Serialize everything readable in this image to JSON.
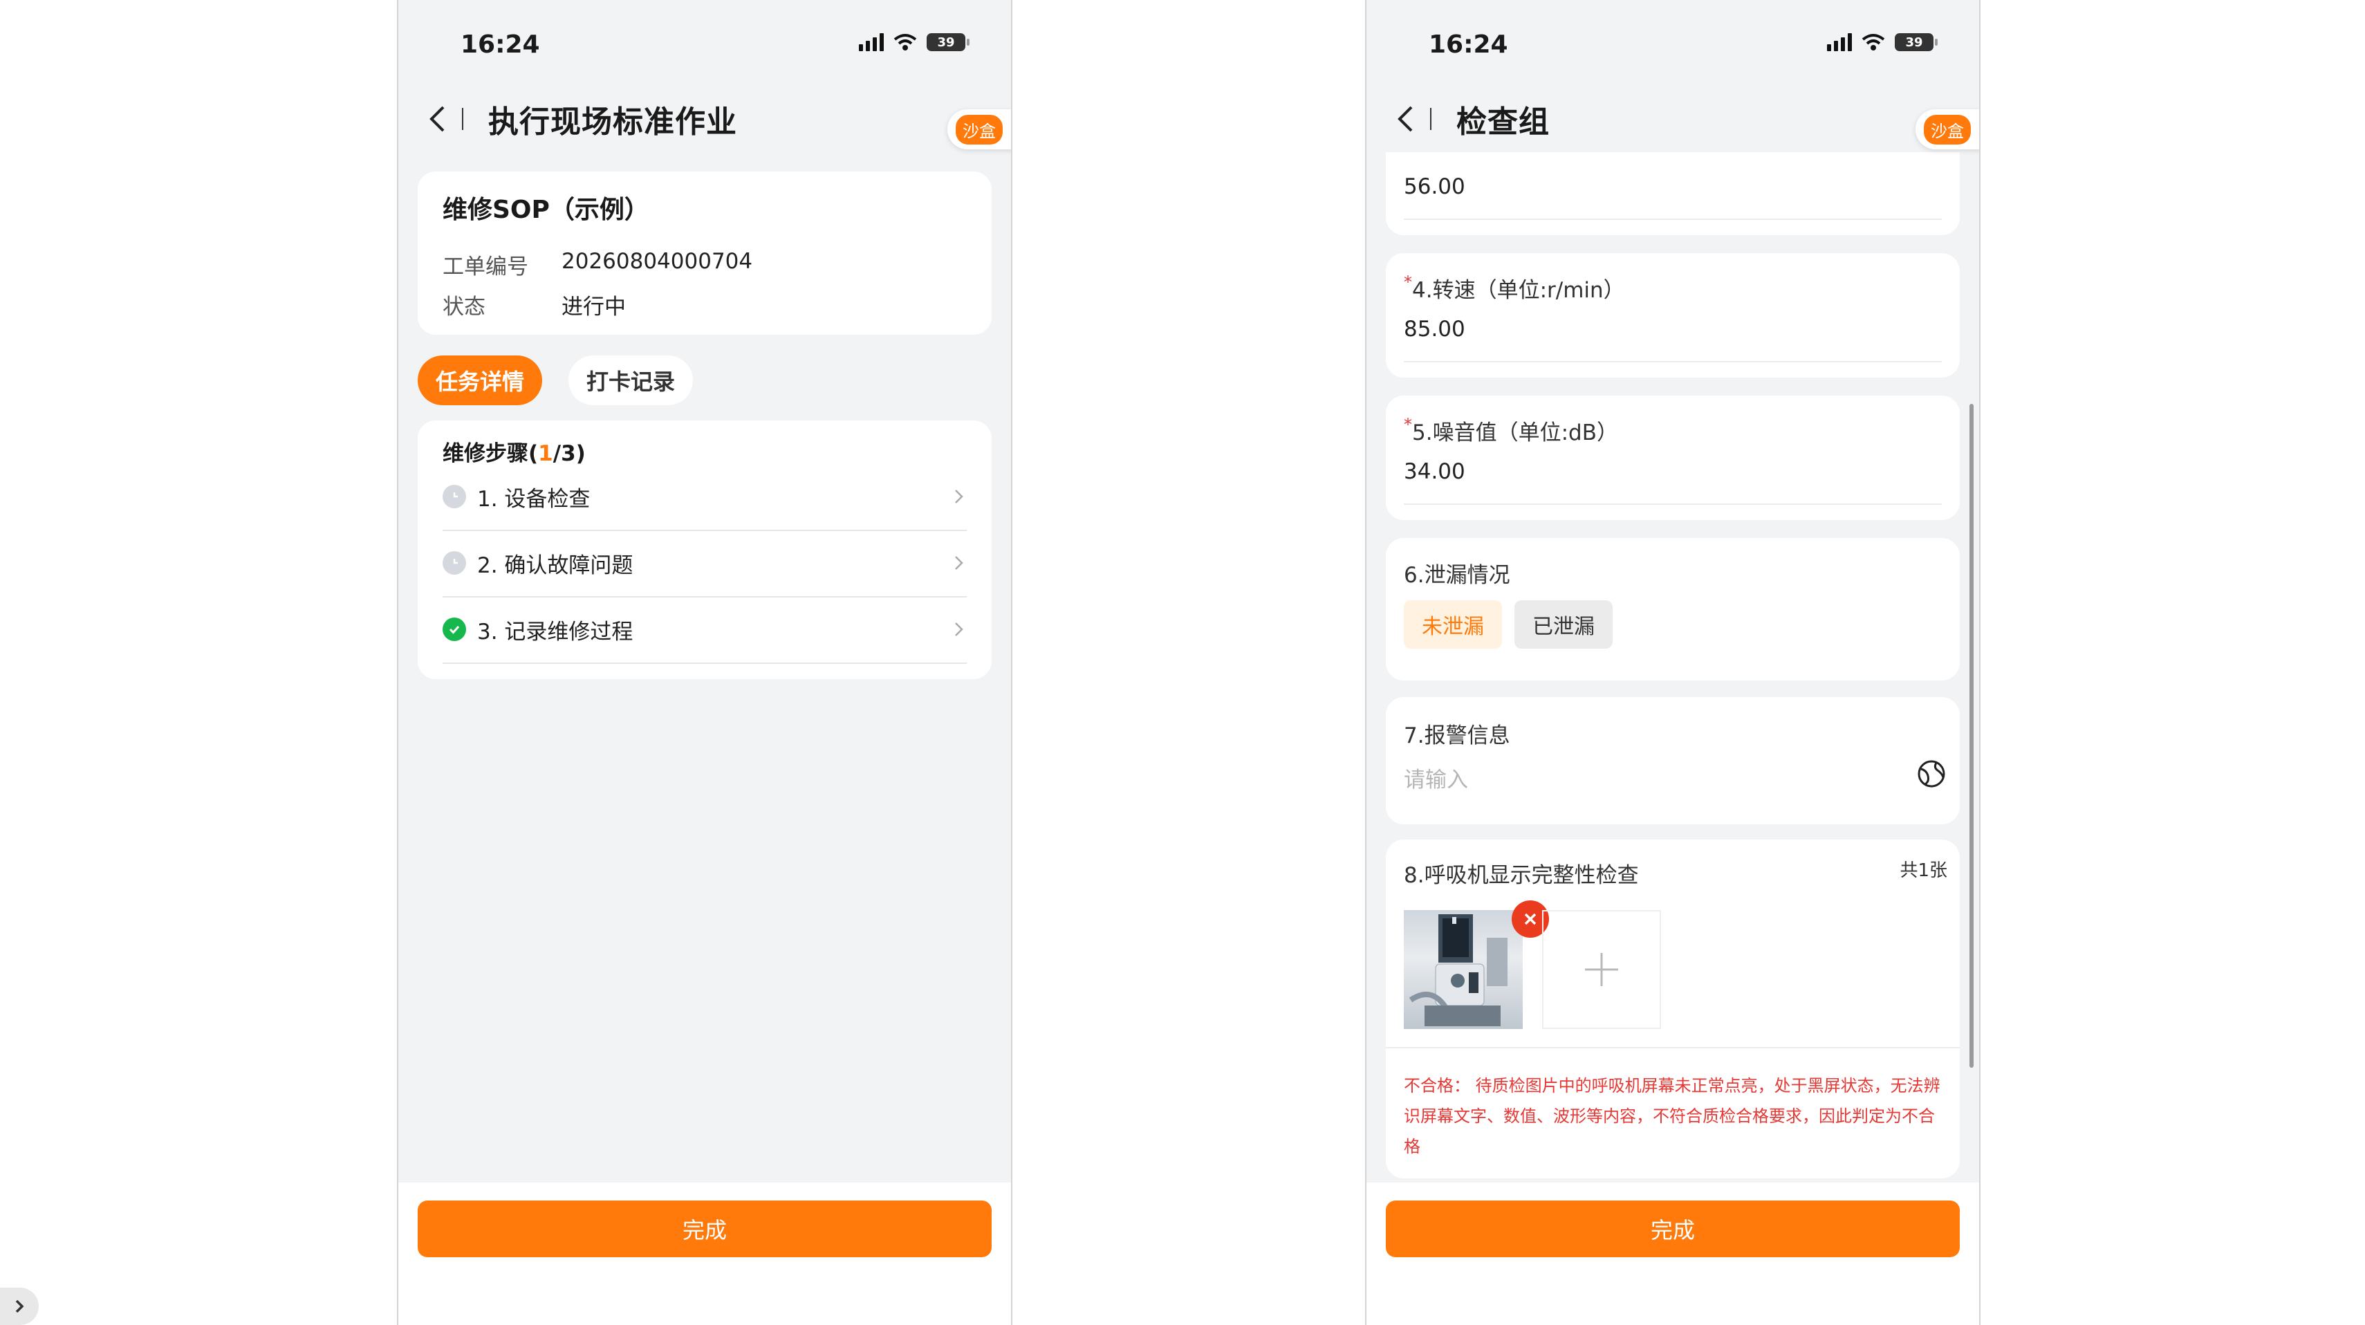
{
  "left_screen": {
    "status": {
      "time": "16:24",
      "battery": "39"
    },
    "nav": {
      "title": "执行现场标准作业",
      "sandbox_label": "沙盒"
    },
    "order": {
      "title": "维修SOP（示例）",
      "fields": [
        {
          "key": "工单编号",
          "value": "20260804000704"
        },
        {
          "key": "状态",
          "value": "进行中"
        }
      ]
    },
    "tabs": [
      {
        "label": "任务详情",
        "active": true
      },
      {
        "label": "打卡记录",
        "active": false
      }
    ],
    "steps": {
      "title_prefix": "维修步骤(",
      "current": "1",
      "title_suffix": "/3)",
      "items": [
        {
          "label": "1. 设备检查",
          "status": "pending",
          "icon": "clock-icon"
        },
        {
          "label": "2. 确认故障问题",
          "status": "pending",
          "icon": "clock-icon"
        },
        {
          "label": "3. 记录维修过程",
          "status": "done",
          "icon": "check-circle-icon"
        }
      ]
    },
    "footer": {
      "done_label": "完成"
    }
  },
  "right_screen": {
    "status": {
      "time": "16:24",
      "battery": "39"
    },
    "nav": {
      "title": "检查组",
      "sandbox_label": "沙盒"
    },
    "fields": {
      "f3": {
        "value": "56.00"
      },
      "f4": {
        "label": "4.转速（单位:r/min）",
        "required": "*",
        "value": "85.00"
      },
      "f5": {
        "label": "5.噪音值（单位:dB）",
        "required": "*",
        "value": "34.00"
      },
      "f6": {
        "label": "6.泄漏情况",
        "options": [
          "未泄漏",
          "已泄漏"
        ],
        "selected": "未泄漏"
      },
      "f7": {
        "label": "7.报警信息",
        "placeholder": "请输入",
        "icon": "globe-icon"
      },
      "f8": {
        "label": "8.呼吸机显示完整性检查",
        "count": "共1张",
        "add_icon": "plus-icon",
        "remove_icon": "close-icon",
        "result_label": "不合格：",
        "result_text": "待质检图片中的呼吸机屏幕未正常点亮，处于黑屏状态，无法辨识屏幕文字、数值、波形等内容，不符合质检合格要求，因此判定为不合格"
      }
    },
    "footer": {
      "done_label": "完成"
    }
  },
  "colors": {
    "accent": "#ff7a0a",
    "success": "#16b84e",
    "error": "#e53935",
    "background": "#f2f3f5"
  },
  "side_handle": {
    "icon": "chevron-right-icon"
  }
}
